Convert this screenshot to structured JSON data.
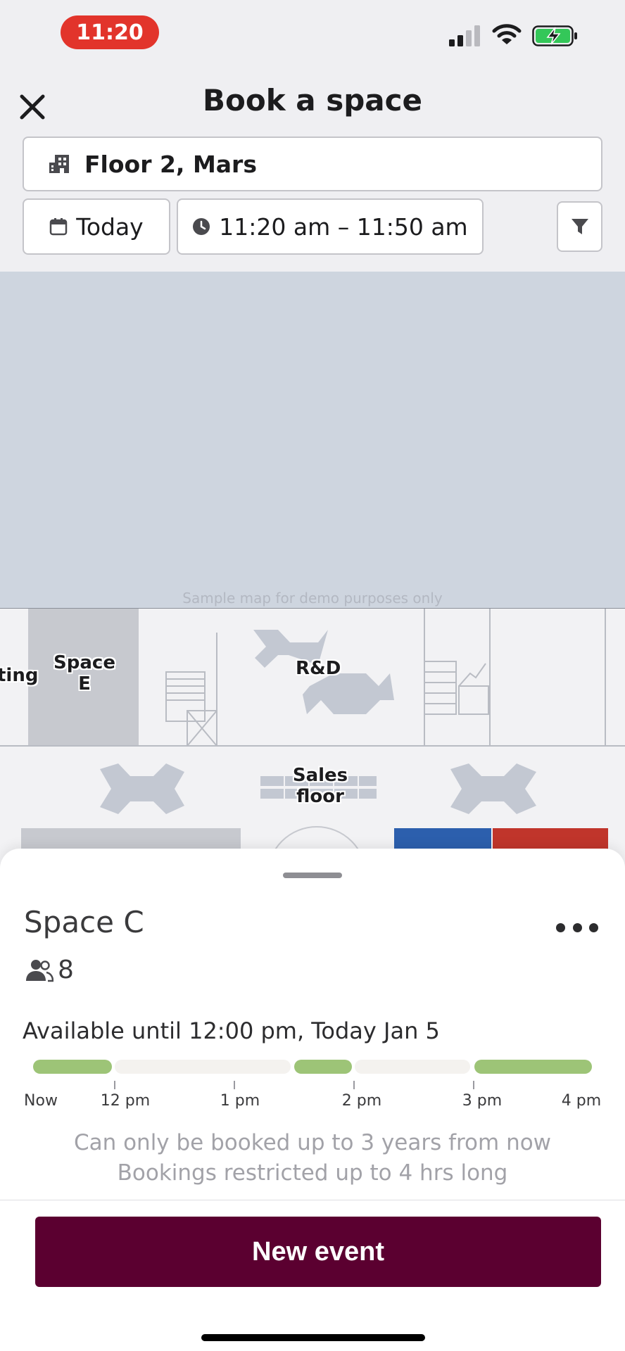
{
  "status_bar": {
    "time": "11:20"
  },
  "header": {
    "title": "Book a space"
  },
  "filters": {
    "location": "Floor 2, Mars",
    "date": "Today",
    "time_range": "11:20 am – 11:50 am"
  },
  "map": {
    "note": "Sample map for demo purposes only",
    "labels": {
      "meeting_partial": "ting",
      "space_e": "Space\nE",
      "rnd": "R&D",
      "sales": "Sales\nfloor"
    }
  },
  "space": {
    "name": "Space C",
    "capacity": "8",
    "availability": "Available until 12:00 pm, Today Jan 5",
    "timeline": {
      "labels": [
        "Now",
        "12 pm",
        "1 pm",
        "2 pm",
        "3 pm",
        "4 pm"
      ],
      "segments": [
        {
          "state": "available"
        },
        {
          "state": "booked"
        },
        {
          "state": "available"
        },
        {
          "state": "booked"
        },
        {
          "state": "available"
        }
      ]
    },
    "restriction_1": "Can only be booked up to 3 years from now",
    "restriction_2": "Bookings restricted up to 4 hrs long"
  },
  "actions": {
    "new_event": "New event"
  },
  "colors": {
    "accent": "#5b0030",
    "available": "#9dc477",
    "booked": "#f4f2ef",
    "time_pill": "#e2342b",
    "battery_charge": "#34c759",
    "room_blue": "#2c5fad",
    "room_red": "#c0352b"
  }
}
